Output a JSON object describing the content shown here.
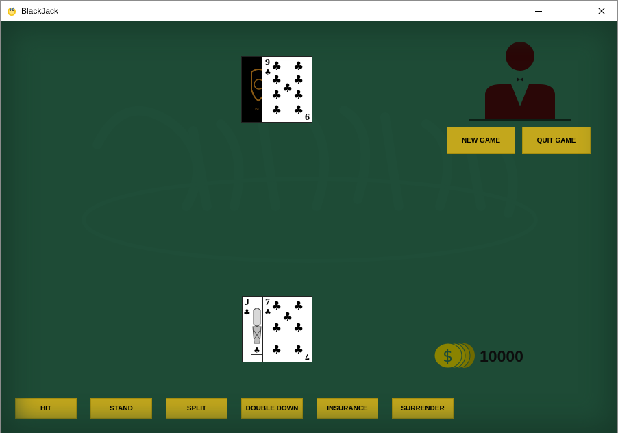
{
  "window": {
    "title": "BlackJack",
    "controls": [
      "minimize",
      "maximize",
      "close"
    ]
  },
  "dealer": {
    "cards": [
      {
        "face": "back"
      },
      {
        "rank": "9",
        "suit": "clubs",
        "symbol": "♣"
      }
    ]
  },
  "player": {
    "cards": [
      {
        "rank": "J",
        "suit": "clubs",
        "symbol": "♣"
      },
      {
        "rank": "7",
        "suit": "clubs",
        "symbol": "♣"
      }
    ],
    "chips": "10000"
  },
  "menu_buttons": {
    "new_game": "NEW GAME",
    "quit_game": "QUIT GAME"
  },
  "actions": {
    "hit": "HIT",
    "stand": "STAND",
    "split": "SPLIT",
    "double_down": "DOUBLE DOWN",
    "insurance": "INSURANCE",
    "surrender": "SURRENDER"
  },
  "colors": {
    "felt": "#1e4b36",
    "button": "#c3a71c",
    "dealer_figure": "#2a0707",
    "coin": "#8a8300"
  },
  "icons": [
    "pygame-snake-icon",
    "dealer-icon",
    "coin-stack-icon",
    "dollar-sign-icon"
  ]
}
